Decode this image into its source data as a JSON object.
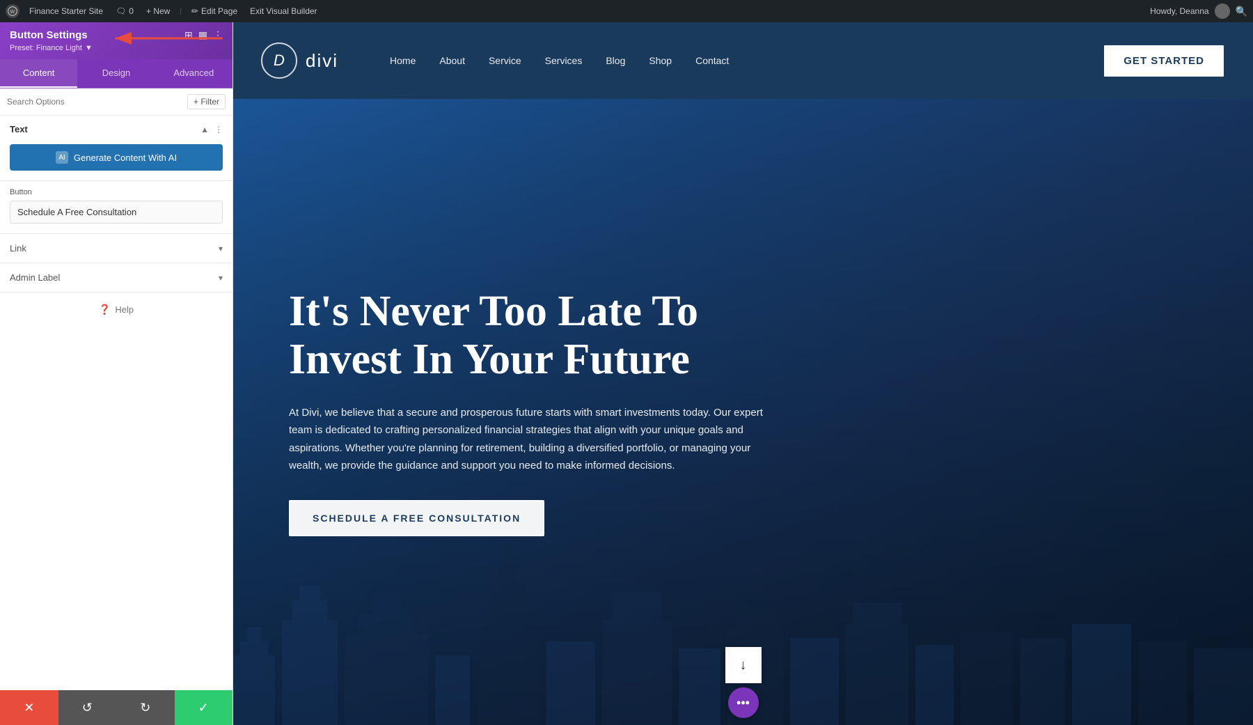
{
  "admin_bar": {
    "wp_label": "WordPress",
    "site_name": "Finance Starter Site",
    "comments_label": "0",
    "new_label": "+ New",
    "new_badge": "New",
    "edit_page_label": "Edit Page",
    "exit_builder_label": "Exit Visual Builder",
    "howdy_label": "Howdy, Deanna",
    "search_icon": "🔍"
  },
  "panel": {
    "title": "Button Settings",
    "preset_label": "Preset: Finance Light",
    "tabs": [
      {
        "id": "content",
        "label": "Content"
      },
      {
        "id": "design",
        "label": "Design"
      },
      {
        "id": "advanced",
        "label": "Advanced"
      }
    ],
    "active_tab": "content",
    "search_placeholder": "Search Options",
    "filter_label": "+ Filter",
    "text_section": {
      "title": "Text",
      "ai_button_label": "Generate Content With AI",
      "ai_icon_label": "AI"
    },
    "button_section": {
      "label": "Button",
      "value": "Schedule A Free Consultation"
    },
    "link_section": {
      "title": "Link"
    },
    "admin_label_section": {
      "title": "Admin Label"
    },
    "help_label": "Help"
  },
  "bottom_bar": {
    "cancel_icon": "✕",
    "undo_icon": "↺",
    "redo_icon": "↻",
    "save_icon": "✓"
  },
  "site_header": {
    "logo_letter": "D",
    "logo_name": "divi",
    "nav_items": [
      {
        "label": "Home"
      },
      {
        "label": "About"
      },
      {
        "label": "Service"
      },
      {
        "label": "Services"
      },
      {
        "label": "Blog"
      },
      {
        "label": "Shop"
      },
      {
        "label": "Contact"
      }
    ],
    "cta_label": "GET STARTED"
  },
  "hero": {
    "title": "It's Never Too Late To Invest In Your Future",
    "description": "At Divi, we believe that a secure and prosperous future starts with smart investments today. Our expert team is dedicated to crafting personalized financial strategies that align with your unique goals and aspirations. Whether you're planning for retirement, building a diversified portfolio, or managing your wealth, we provide the guidance and support you need to make informed decisions.",
    "cta_label": "SCHEDULE A FREE CONSULTATION",
    "scroll_down_icon": "↓",
    "dots_icon": "•••"
  }
}
